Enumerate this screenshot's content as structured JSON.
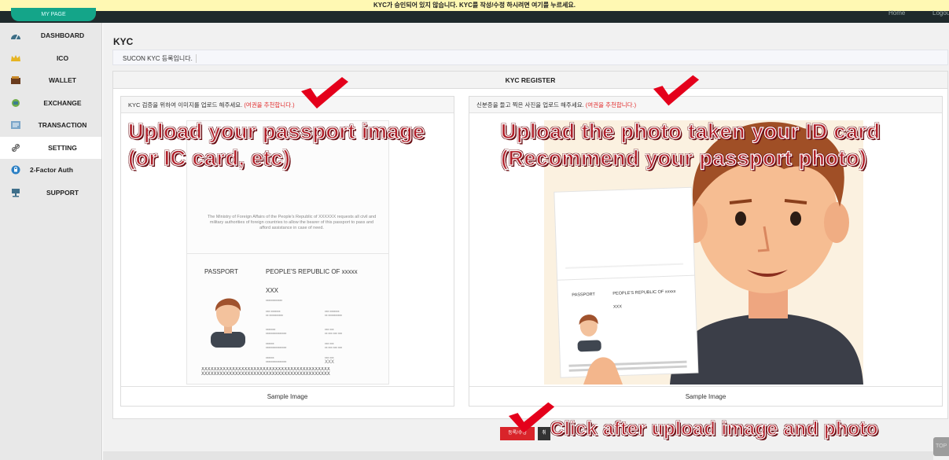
{
  "notice_bar": {
    "text": "KYC가 승인되어 있지 않습니다. KYC를 작성/수정 하시려면 여기를 누르세요."
  },
  "header": {
    "mypage_label": "MY PAGE",
    "home_link": "Home",
    "logout_link": "Logout"
  },
  "sidebar": {
    "items": [
      {
        "label": "DASHBOARD",
        "icon": "dashboard-icon"
      },
      {
        "label": "ICO",
        "icon": "crown-icon"
      },
      {
        "label": "WALLET",
        "icon": "wallet-icon"
      },
      {
        "label": "EXCHANGE",
        "icon": "exchange-icon"
      },
      {
        "label": "TRANSACTION",
        "icon": "transaction-icon"
      },
      {
        "label": "SETTING",
        "icon": "link-icon",
        "active": true
      },
      {
        "label": "2-Factor Auth",
        "icon": "lock-icon"
      },
      {
        "label": "SUPPORT",
        "icon": "support-icon"
      }
    ]
  },
  "page": {
    "title": "KYC",
    "subtitle": "SUCON KYC 등록입니다.",
    "panel_title": "KYC REGISTER"
  },
  "cards": {
    "left": {
      "instruction": "KYC 검증을 위하여 이미지를 업로드 해주세요. ",
      "recommend": "(여권을 추천합니다.)",
      "footer": "Sample Image"
    },
    "right": {
      "instruction": "신분증을 들고 찍은 사진을 업로드 해주세요. ",
      "recommend": "(여권을 추천합니다.)",
      "footer": "Sample Image"
    }
  },
  "passport_sample": {
    "ministry_text": "The Ministry of Foreign Affairs of the People's Republic of XXXXXX requests all civil and military authorities of foreign countries to allow the bearer of this passport to pass and afford assistance in case of need.",
    "label": "PASSPORT",
    "country": "PEOPLE'S REPUBLIC OF xxxxx",
    "name": "XXX",
    "mrz_line1": "XXXXXXXXXXXXXXXXXXXXXXXXXXXXXXXXXXXXXXXXXX",
    "mrz_line2": "XXXXXXXXXXXXXXXXXXXXXXXXXXXXXXXXXXXXXXXXXX"
  },
  "annotations": {
    "left_line1": "Upload your passport image",
    "left_line2": "(or IC card, etc)",
    "right_line1": "Upload the photo taken your ID card",
    "right_line2": "(Recommend your passport photo)",
    "bottom": "Click after upload image and photo"
  },
  "actions": {
    "submit_label": "등록/수정",
    "cancel_label": "취",
    "top_label": "TOP"
  },
  "colors": {
    "accent_red": "#d9242a",
    "annotation_red": "#b0202a",
    "mypage_green": "#14a589",
    "notice_yellow": "#fff8b3"
  }
}
